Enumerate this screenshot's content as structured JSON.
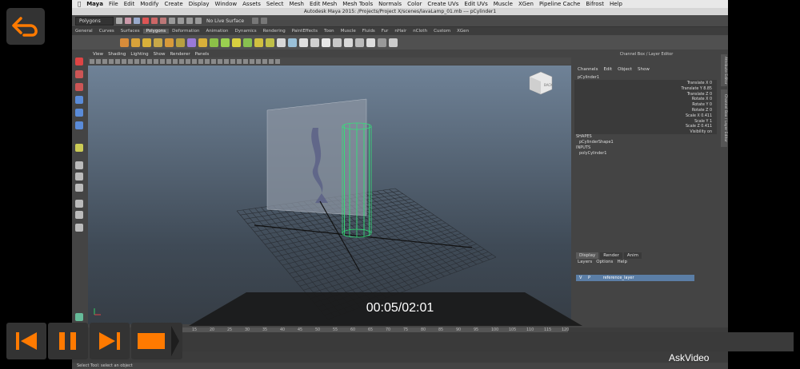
{
  "mac_menu": [
    "Maya",
    "File",
    "Edit",
    "Modify",
    "Create",
    "Display",
    "Window",
    "Assets",
    "Select",
    "Mesh",
    "Edit Mesh",
    "Mesh Tools",
    "Normals",
    "Color",
    "Create UVs",
    "Edit UVs",
    "Muscle",
    "XGen",
    "Pipeline Cache",
    "Bifrost",
    "Help"
  ],
  "window_title": "Autodesk Maya 2015: /Projects/Project X/scenes/lavaLamp_01.mb  ---  pCylinder1",
  "status_line": {
    "menu_set": "Polygons",
    "live_surface": "No Live Surface"
  },
  "shelf_tabs": [
    "General",
    "Curves",
    "Surfaces",
    "Polygons",
    "Deformation",
    "Animation",
    "Dynamics",
    "Rendering",
    "PaintEffects",
    "Toon",
    "Muscle",
    "Fluids",
    "Fur",
    "nHair",
    "nCloth",
    "Custom",
    "XGen"
  ],
  "active_shelf_tab": "Polygons",
  "panel_menu": [
    "View",
    "Shading",
    "Lighting",
    "Show",
    "Renderer",
    "Panels"
  ],
  "view_cube_label": "BACK",
  "channel_box": {
    "title": "Channel Box / Layer Editor",
    "menu": [
      "Channels",
      "Edit",
      "Object",
      "Show"
    ],
    "object": "pCylinder1",
    "attributes": [
      "Translate X 0",
      "Translate Y 8.85",
      "Translate Z 0",
      "Rotate X 0",
      "Rotate Y 0",
      "Rotate Z 0",
      "Scale X 0.411",
      "Scale Y 1",
      "Scale Z 0.411",
      "Visibility on"
    ],
    "shapes_header": "SHAPES",
    "shape": "pCylinderShape1",
    "inputs_header": "INPUTS",
    "input": "polyCylinder1"
  },
  "side_tabs": [
    "Attribute Editor",
    "Channel Box / Layer Editor"
  ],
  "layer_editor": {
    "tabs": [
      "Display",
      "Render",
      "Anim"
    ],
    "menu": [
      "Layers",
      "Options",
      "Help"
    ],
    "layer": {
      "v": "V",
      "p": "P",
      "name": "reference_layer"
    }
  },
  "timeline_ticks": [
    "1",
    "5",
    "10",
    "15",
    "20",
    "25",
    "30",
    "35",
    "40",
    "45",
    "50",
    "55",
    "60",
    "65",
    "70",
    "75",
    "80",
    "85",
    "90",
    "95",
    "100",
    "105",
    "110",
    "115",
    "120"
  ],
  "status_bar": "Select Tool: select an object",
  "player": {
    "timecode": "00:05/02:01",
    "watermark": "AskVideo"
  },
  "colors": {
    "accent": "#ff7a00",
    "wire": "#35e07a",
    "layer": "#5b7ea6"
  }
}
